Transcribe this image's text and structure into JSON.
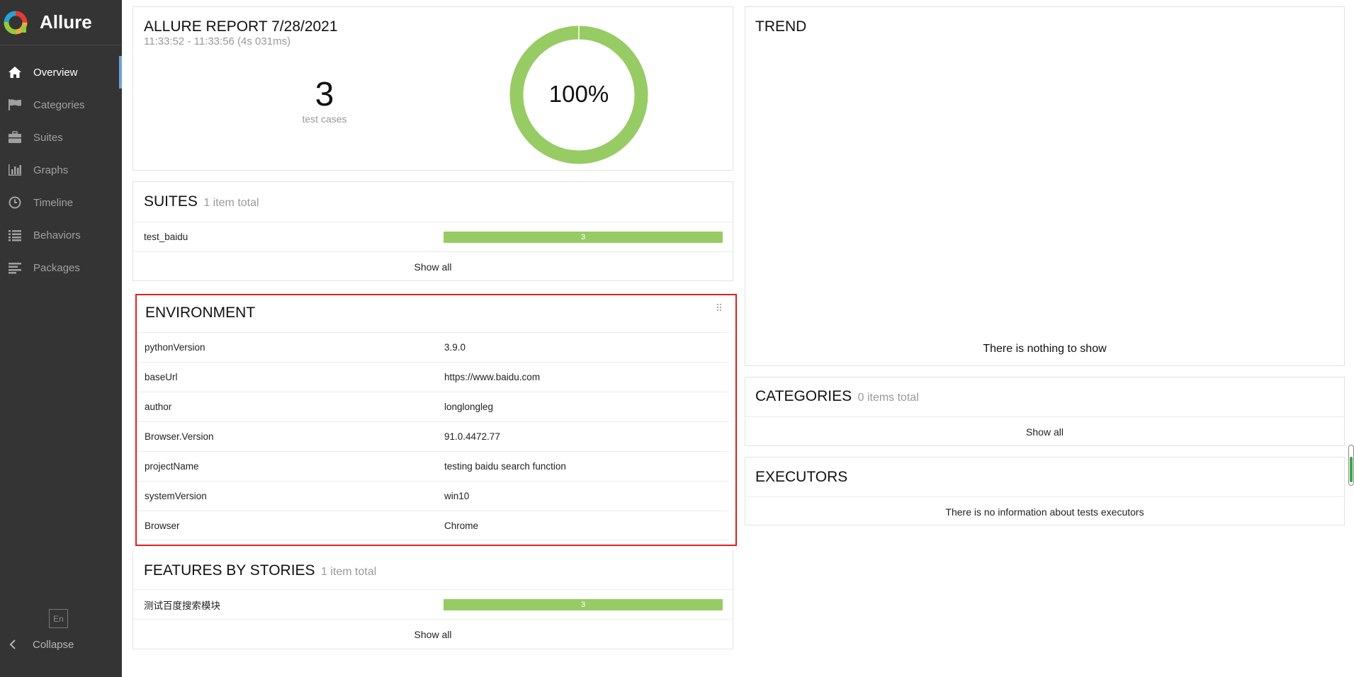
{
  "brand": {
    "name": "Allure"
  },
  "sidebar": {
    "items": [
      {
        "label": "Overview",
        "icon": "home-icon"
      },
      {
        "label": "Categories",
        "icon": "flag-icon"
      },
      {
        "label": "Suites",
        "icon": "briefcase-icon"
      },
      {
        "label": "Graphs",
        "icon": "bar-chart-icon"
      },
      {
        "label": "Timeline",
        "icon": "clock-icon"
      },
      {
        "label": "Behaviors",
        "icon": "list-icon"
      },
      {
        "label": "Packages",
        "icon": "align-left-icon"
      }
    ],
    "language": "En",
    "collapse": "Collapse"
  },
  "summary": {
    "title": "ALLURE REPORT 7/28/2021",
    "time": "11:33:52 - 11:33:56 (4s 031ms)",
    "test_count": "3",
    "test_label": "test cases",
    "percent": "100%",
    "passed_fraction": 1.0,
    "color": "#97cc64"
  },
  "suites": {
    "title": "SUITES",
    "count": "1 item total",
    "rows": [
      {
        "name": "test_baidu",
        "value": "3"
      }
    ],
    "show_all": "Show all"
  },
  "environment": {
    "title": "ENVIRONMENT",
    "rows": [
      {
        "key": "pythonVersion",
        "value": "3.9.0"
      },
      {
        "key": "baseUrl",
        "value": "https://www.baidu.com"
      },
      {
        "key": "author",
        "value": "longlongleg"
      },
      {
        "key": "Browser.Version",
        "value": "91.0.4472.77"
      },
      {
        "key": "projectName",
        "value": "testing baidu search function"
      },
      {
        "key": "systemVersion",
        "value": "win10"
      },
      {
        "key": "Browser",
        "value": "Chrome"
      }
    ]
  },
  "features": {
    "title": "FEATURES BY STORIES",
    "count": "1 item total",
    "rows": [
      {
        "name": "测试百度搜索模块",
        "value": "3"
      }
    ],
    "show_all": "Show all"
  },
  "trend": {
    "title": "TREND",
    "empty": "There is nothing to show"
  },
  "categories": {
    "title": "CATEGORIES",
    "count": "0 items total",
    "show_all": "Show all"
  },
  "executors": {
    "title": "EXECUTORS",
    "empty": "There is no information about tests executors"
  }
}
